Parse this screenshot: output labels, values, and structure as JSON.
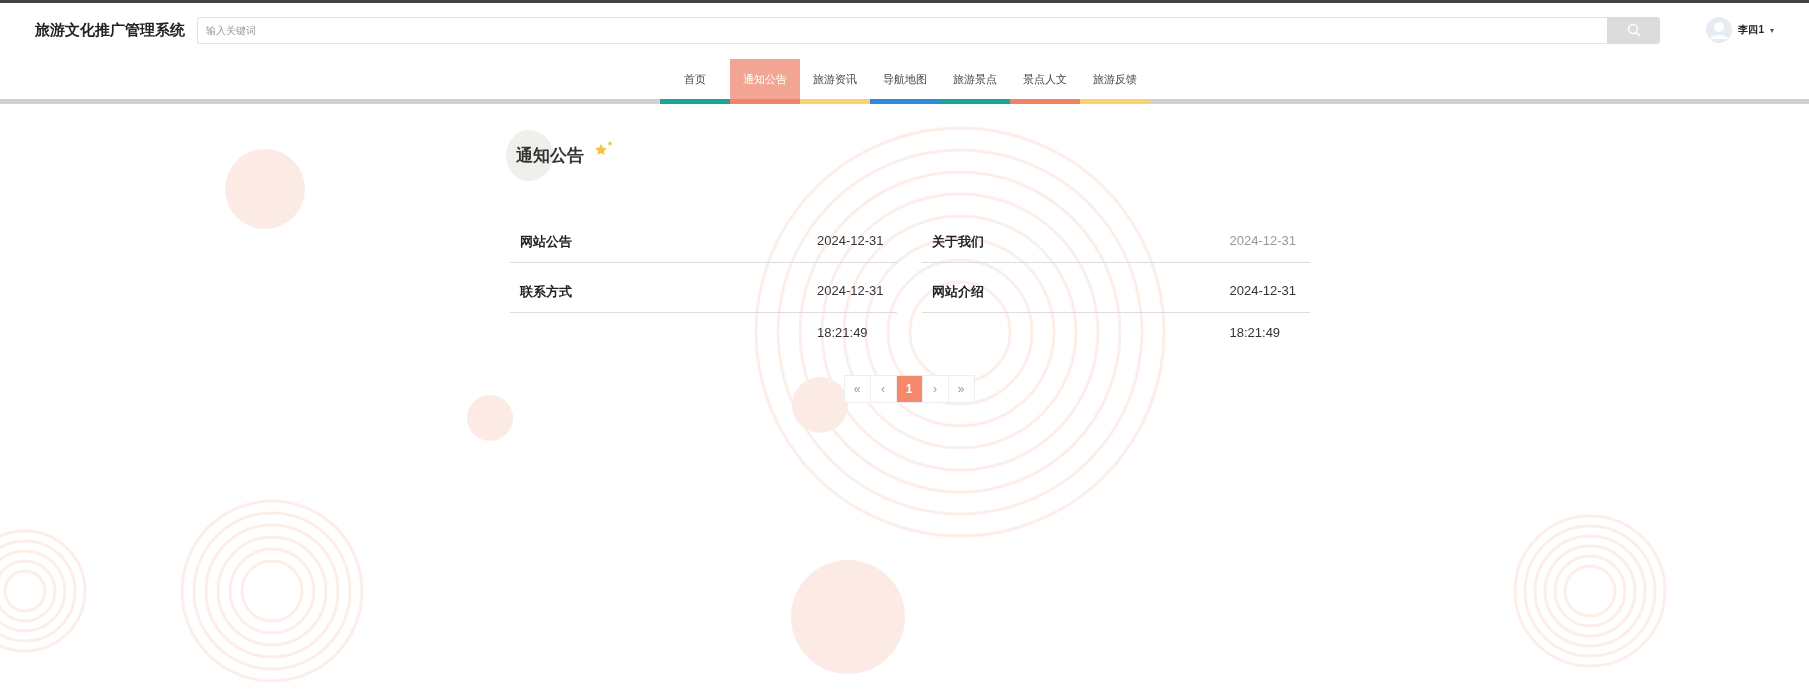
{
  "header": {
    "site_title": "旅游文化推广管理系统",
    "search": {
      "placeholder": "输入关键词"
    },
    "user": {
      "name": "李四1",
      "caret": "▾"
    }
  },
  "nav": [
    {
      "label": "首页",
      "selected": false,
      "color": "#1aa594"
    },
    {
      "label": "通知公告",
      "selected": true,
      "color": "#f08468"
    },
    {
      "label": "旅游资讯",
      "selected": false,
      "color": "#fcd26e"
    },
    {
      "label": "导航地图",
      "selected": false,
      "color": "#2f8bd8"
    },
    {
      "label": "旅游景点",
      "selected": false,
      "color": "#1aa594"
    },
    {
      "label": "景点人文",
      "selected": false,
      "color": "#f08468"
    },
    {
      "label": "旅游反馈",
      "selected": false,
      "color": "#fcd26e"
    }
  ],
  "section_title": "通知公告",
  "notices": [
    {
      "title": "网站公告",
      "date": "2024-12-31",
      "hovered": false
    },
    {
      "title": "关于我们",
      "date": "2024-12-31",
      "hovered": true
    },
    {
      "title": "联系方式",
      "date": "2024-12-31",
      "time": "18:21:49",
      "hovered": false
    },
    {
      "title": "网站介绍",
      "date": "2024-12-31",
      "time": "18:21:49",
      "hovered": false
    }
  ],
  "pagination": [
    {
      "label": "«",
      "selected": false
    },
    {
      "label": "‹",
      "selected": false
    },
    {
      "label": "1",
      "selected": true
    },
    {
      "label": "›",
      "selected": false
    },
    {
      "label": "»",
      "selected": false
    }
  ]
}
